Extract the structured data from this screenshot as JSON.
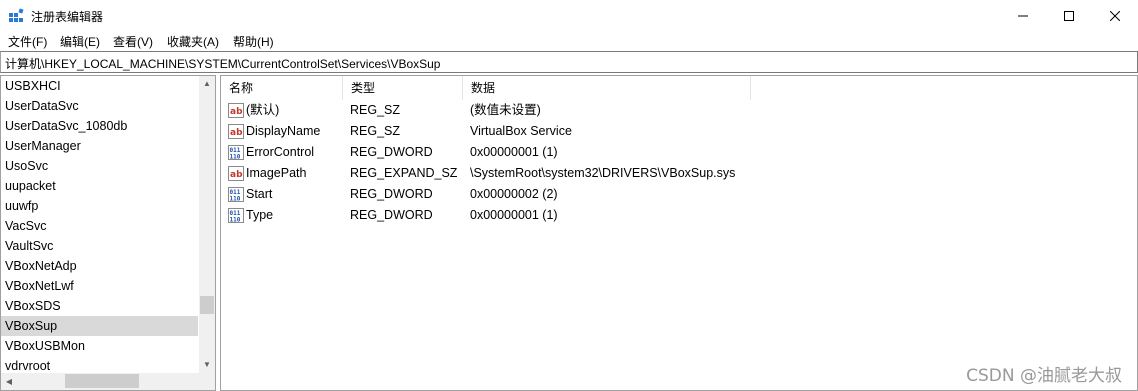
{
  "window": {
    "title": "注册表编辑器",
    "controls": {
      "minimize": "—",
      "maximize": "☐",
      "close": "✕"
    }
  },
  "menu": [
    "文件(F)",
    "编辑(E)",
    "查看(V)",
    "收藏夹(A)",
    "帮助(H)"
  ],
  "address": "计算机\\HKEY_LOCAL_MACHINE\\SYSTEM\\CurrentControlSet\\Services\\VBoxSup",
  "tree": {
    "items": [
      "USBXHCI",
      "UserDataSvc",
      "UserDataSvc_1080db",
      "UserManager",
      "UsoSvc",
      "uupacket",
      "uuwfp",
      "VacSvc",
      "VaultSvc",
      "VBoxNetAdp",
      "VBoxNetLwf",
      "VBoxSDS",
      "VBoxSup",
      "VBoxUSBMon",
      "vdrvroot"
    ],
    "selected": "VBoxSup"
  },
  "columns": {
    "name": "名称",
    "type": "类型",
    "data": "数据"
  },
  "values": [
    {
      "icon": "string-value-icon",
      "name": "(默认)",
      "type": "REG_SZ",
      "data": "(数值未设置)"
    },
    {
      "icon": "string-value-icon",
      "name": "DisplayName",
      "type": "REG_SZ",
      "data": "VirtualBox Service"
    },
    {
      "icon": "dword-value-icon",
      "name": "ErrorControl",
      "type": "REG_DWORD",
      "data": "0x00000001 (1)"
    },
    {
      "icon": "string-value-icon",
      "name": "ImagePath",
      "type": "REG_EXPAND_SZ",
      "data": "\\SystemRoot\\system32\\DRIVERS\\VBoxSup.sys"
    },
    {
      "icon": "dword-value-icon",
      "name": "Start",
      "type": "REG_DWORD",
      "data": "0x00000002 (2)"
    },
    {
      "icon": "dword-value-icon",
      "name": "Type",
      "type": "REG_DWORD",
      "data": "0x00000001 (1)"
    }
  ],
  "watermark": "CSDN @油腻老大叔",
  "colors": {
    "selection": "#d9d9d9",
    "string_icon_red": "#c0392b",
    "dword_icon_blue": "#1f4fa8"
  }
}
